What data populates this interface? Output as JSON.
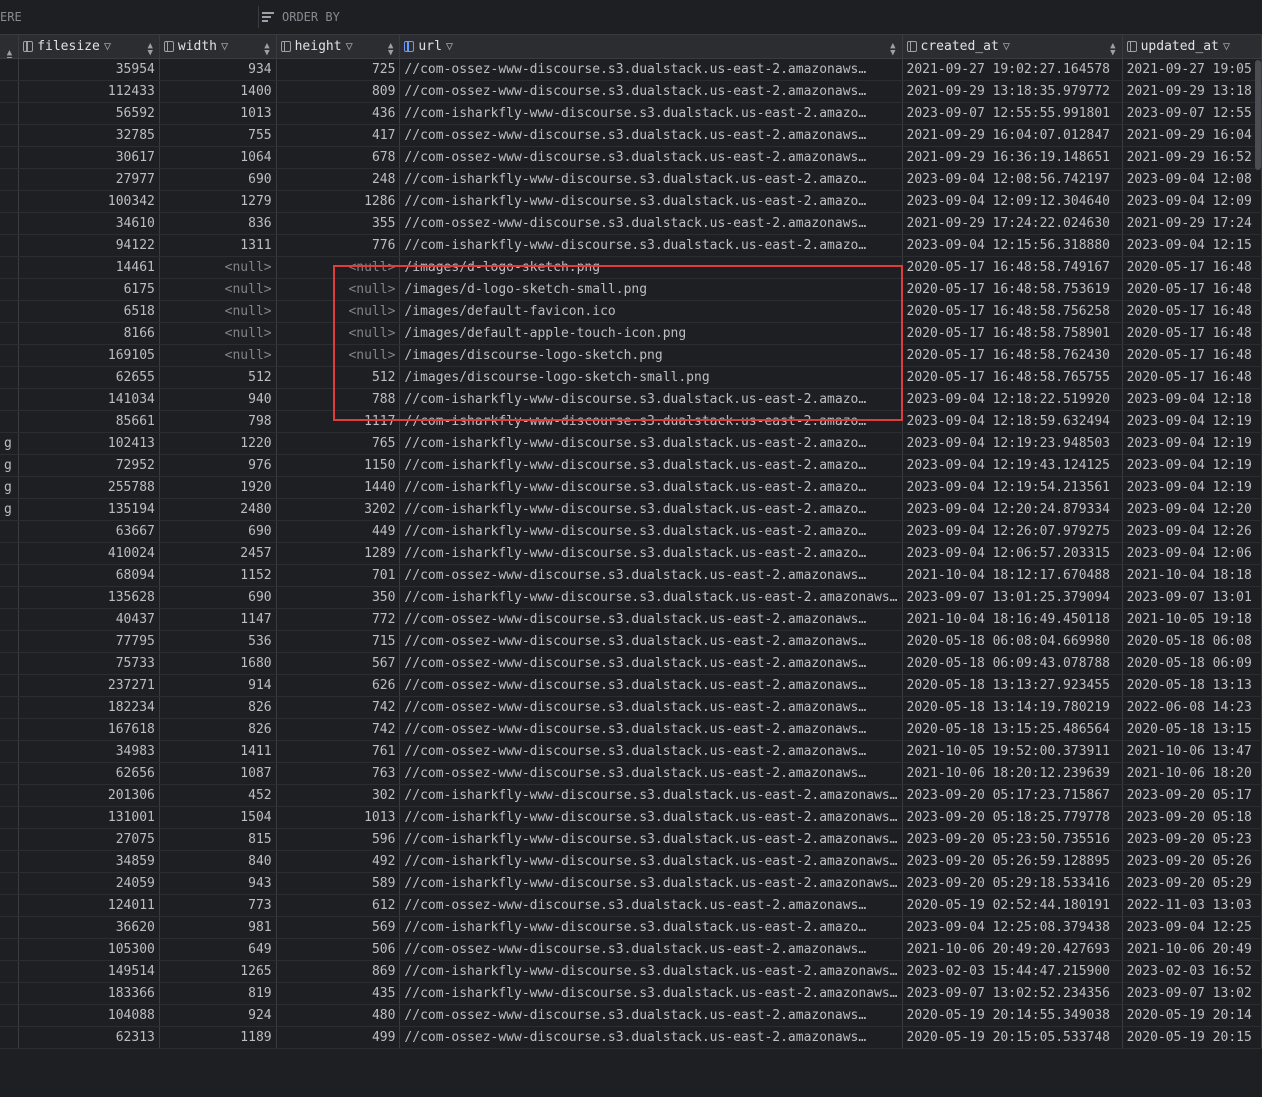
{
  "filter_bar": {
    "where_label": "ERE",
    "order_by_label": "ORDER BY"
  },
  "columns": [
    {
      "label": "",
      "icon": ""
    },
    {
      "label": "filesize",
      "icon": "column-icon"
    },
    {
      "label": "width",
      "icon": "column-icon"
    },
    {
      "label": "height",
      "icon": "column-icon"
    },
    {
      "label": "url",
      "icon": "key-column-icon"
    },
    {
      "label": "created_at",
      "icon": "column-icon"
    },
    {
      "label": "updated_at",
      "icon": "column-icon"
    }
  ],
  "rows": [
    [
      "",
      "35954",
      "934",
      "725",
      "//com-ossez-www-discourse.s3.dualstack.us-east-2.amazonaws…",
      "2021-09-27 19:02:27.164578",
      "2021-09-27 19:05"
    ],
    [
      "",
      "112433",
      "1400",
      "809",
      "//com-ossez-www-discourse.s3.dualstack.us-east-2.amazonaws…",
      "2021-09-29 13:18:35.979772",
      "2021-09-29 13:18"
    ],
    [
      "",
      "56592",
      "1013",
      "436",
      "//com-isharkfly-www-discourse.s3.dualstack.us-east-2.amazo…",
      "2023-09-07 12:55:55.991801",
      "2023-09-07 12:55"
    ],
    [
      "",
      "32785",
      "755",
      "417",
      "//com-ossez-www-discourse.s3.dualstack.us-east-2.amazonaws…",
      "2021-09-29 16:04:07.012847",
      "2021-09-29 16:04"
    ],
    [
      "",
      "30617",
      "1064",
      "678",
      "//com-ossez-www-discourse.s3.dualstack.us-east-2.amazonaws…",
      "2021-09-29 16:36:19.148651",
      "2021-09-29 16:52"
    ],
    [
      "",
      "27977",
      "690",
      "248",
      "//com-isharkfly-www-discourse.s3.dualstack.us-east-2.amazo…",
      "2023-09-04 12:08:56.742197",
      "2023-09-04 12:08"
    ],
    [
      "",
      "100342",
      "1279",
      "1286",
      "//com-isharkfly-www-discourse.s3.dualstack.us-east-2.amazo…",
      "2023-09-04 12:09:12.304640",
      "2023-09-04 12:09"
    ],
    [
      "",
      "34610",
      "836",
      "355",
      "//com-ossez-www-discourse.s3.dualstack.us-east-2.amazonaws…",
      "2021-09-29 17:24:22.024630",
      "2021-09-29 17:24"
    ],
    [
      "",
      "94122",
      "1311",
      "776",
      "//com-isharkfly-www-discourse.s3.dualstack.us-east-2.amazo…",
      "2023-09-04 12:15:56.318880",
      "2023-09-04 12:15"
    ],
    [
      "",
      "14461",
      "<null>",
      "<null>",
      "/images/d-logo-sketch.png",
      "2020-05-17 16:48:58.749167",
      "2020-05-17 16:48"
    ],
    [
      "",
      "6175",
      "<null>",
      "<null>",
      "/images/d-logo-sketch-small.png",
      "2020-05-17 16:48:58.753619",
      "2020-05-17 16:48"
    ],
    [
      "",
      "6518",
      "<null>",
      "<null>",
      "/images/default-favicon.ico",
      "2020-05-17 16:48:58.756258",
      "2020-05-17 16:48"
    ],
    [
      "",
      "8166",
      "<null>",
      "<null>",
      "/images/default-apple-touch-icon.png",
      "2020-05-17 16:48:58.758901",
      "2020-05-17 16:48"
    ],
    [
      "",
      "169105",
      "<null>",
      "<null>",
      "/images/discourse-logo-sketch.png",
      "2020-05-17 16:48:58.762430",
      "2020-05-17 16:48"
    ],
    [
      "",
      "62655",
      "512",
      "512",
      "/images/discourse-logo-sketch-small.png",
      "2020-05-17 16:48:58.765755",
      "2020-05-17 16:48"
    ],
    [
      "",
      "141034",
      "940",
      "788",
      "//com-isharkfly-www-discourse.s3.dualstack.us-east-2.amazo…",
      "2023-09-04 12:18:22.519920",
      "2023-09-04 12:18"
    ],
    [
      "",
      "85661",
      "798",
      "1117",
      "//com-isharkfly-www-discourse.s3.dualstack.us-east-2.amazo…",
      "2023-09-04 12:18:59.632494",
      "2023-09-04 12:19"
    ],
    [
      "g",
      "102413",
      "1220",
      "765",
      "//com-isharkfly-www-discourse.s3.dualstack.us-east-2.amazo…",
      "2023-09-04 12:19:23.948503",
      "2023-09-04 12:19"
    ],
    [
      "g",
      "72952",
      "976",
      "1150",
      "//com-isharkfly-www-discourse.s3.dualstack.us-east-2.amazo…",
      "2023-09-04 12:19:43.124125",
      "2023-09-04 12:19"
    ],
    [
      "g",
      "255788",
      "1920",
      "1440",
      "//com-isharkfly-www-discourse.s3.dualstack.us-east-2.amazo…",
      "2023-09-04 12:19:54.213561",
      "2023-09-04 12:19"
    ],
    [
      "g",
      "135194",
      "2480",
      "3202",
      "//com-isharkfly-www-discourse.s3.dualstack.us-east-2.amazo…",
      "2023-09-04 12:20:24.879334",
      "2023-09-04 12:20"
    ],
    [
      "",
      "63667",
      "690",
      "449",
      "//com-isharkfly-www-discourse.s3.dualstack.us-east-2.amazo…",
      "2023-09-04 12:26:07.979275",
      "2023-09-04 12:26"
    ],
    [
      "",
      "410024",
      "2457",
      "1289",
      "//com-isharkfly-www-discourse.s3.dualstack.us-east-2.amazo…",
      "2023-09-04 12:06:57.203315",
      "2023-09-04 12:06"
    ],
    [
      "",
      "68094",
      "1152",
      "701",
      "//com-ossez-www-discourse.s3.dualstack.us-east-2.amazonaws…",
      "2021-10-04 18:12:17.670488",
      "2021-10-04 18:18"
    ],
    [
      "",
      "135628",
      "690",
      "350",
      "//com-isharkfly-www-discourse.s3.dualstack.us-east-2.amazonaws…",
      "2023-09-07 13:01:25.379094",
      "2023-09-07 13:01"
    ],
    [
      "",
      "40437",
      "1147",
      "772",
      "//com-ossez-www-discourse.s3.dualstack.us-east-2.amazonaws…",
      "2021-10-04 18:16:49.450118",
      "2021-10-05 19:18"
    ],
    [
      "",
      "77795",
      "536",
      "715",
      "//com-ossez-www-discourse.s3.dualstack.us-east-2.amazonaws…",
      "2020-05-18 06:08:04.669980",
      "2020-05-18 06:08"
    ],
    [
      "",
      "75733",
      "1680",
      "567",
      "//com-ossez-www-discourse.s3.dualstack.us-east-2.amazonaws…",
      "2020-05-18 06:09:43.078788",
      "2020-05-18 06:09"
    ],
    [
      "",
      "237271",
      "914",
      "626",
      "//com-ossez-www-discourse.s3.dualstack.us-east-2.amazonaws…",
      "2020-05-18 13:13:27.923455",
      "2020-05-18 13:13"
    ],
    [
      "",
      "182234",
      "826",
      "742",
      "//com-ossez-www-discourse.s3.dualstack.us-east-2.amazonaws…",
      "2020-05-18 13:14:19.780219",
      "2022-06-08 14:23"
    ],
    [
      "",
      "167618",
      "826",
      "742",
      "//com-ossez-www-discourse.s3.dualstack.us-east-2.amazonaws…",
      "2020-05-18 13:15:25.486564",
      "2020-05-18 13:15"
    ],
    [
      "",
      "34983",
      "1411",
      "761",
      "//com-ossez-www-discourse.s3.dualstack.us-east-2.amazonaws…",
      "2021-10-05 19:52:00.373911",
      "2021-10-06 13:47"
    ],
    [
      "",
      "62656",
      "1087",
      "763",
      "//com-ossez-www-discourse.s3.dualstack.us-east-2.amazonaws…",
      "2021-10-06 18:20:12.239639",
      "2021-10-06 18:20"
    ],
    [
      "",
      "201306",
      "452",
      "302",
      "//com-isharkfly-www-discourse.s3.dualstack.us-east-2.amazonaws…",
      "2023-09-20 05:17:23.715867",
      "2023-09-20 05:17"
    ],
    [
      "",
      "131001",
      "1504",
      "1013",
      "//com-isharkfly-www-discourse.s3.dualstack.us-east-2.amazonaws…",
      "2023-09-20 05:18:25.779778",
      "2023-09-20 05:18"
    ],
    [
      "",
      "27075",
      "815",
      "596",
      "//com-isharkfly-www-discourse.s3.dualstack.us-east-2.amazonaws…",
      "2023-09-20 05:23:50.735516",
      "2023-09-20 05:23"
    ],
    [
      "",
      "34859",
      "840",
      "492",
      "//com-isharkfly-www-discourse.s3.dualstack.us-east-2.amazonaws…",
      "2023-09-20 05:26:59.128895",
      "2023-09-20 05:26"
    ],
    [
      "",
      "24059",
      "943",
      "589",
      "//com-isharkfly-www-discourse.s3.dualstack.us-east-2.amazonaws…",
      "2023-09-20 05:29:18.533416",
      "2023-09-20 05:29"
    ],
    [
      "",
      "124011",
      "773",
      "612",
      "//com-ossez-www-discourse.s3.dualstack.us-east-2.amazonaws…",
      "2020-05-19 02:52:44.180191",
      "2022-11-03 13:03"
    ],
    [
      "",
      "36620",
      "981",
      "569",
      "//com-isharkfly-www-discourse.s3.dualstack.us-east-2.amazo…",
      "2023-09-04 12:25:08.379438",
      "2023-09-04 12:25"
    ],
    [
      "",
      "105300",
      "649",
      "506",
      "//com-ossez-www-discourse.s3.dualstack.us-east-2.amazonaws…",
      "2021-10-06 20:49:20.427693",
      "2021-10-06 20:49"
    ],
    [
      "",
      "149514",
      "1265",
      "869",
      "//com-isharkfly-www-discourse.s3.dualstack.us-east-2.amazonaws…",
      "2023-02-03 15:44:47.215900",
      "2023-02-03 16:52"
    ],
    [
      "",
      "183366",
      "819",
      "435",
      "//com-isharkfly-www-discourse.s3.dualstack.us-east-2.amazonaws…",
      "2023-09-07 13:02:52.234356",
      "2023-09-07 13:02"
    ],
    [
      "",
      "104088",
      "924",
      "480",
      "//com-ossez-www-discourse.s3.dualstack.us-east-2.amazonaws…",
      "2020-05-19 20:14:55.349038",
      "2020-05-19 20:14"
    ],
    [
      "",
      "62313",
      "1189",
      "499",
      "//com-ossez-www-discourse.s3.dualstack.us-east-2.amazonaws…",
      "2020-05-19 20:15:05.533748",
      "2020-05-19 20:15"
    ]
  ],
  "colors": {
    "highlight": "#e03c3c",
    "background": "#1e1f22",
    "header": "#2b2d30",
    "null_text": "#80838a"
  }
}
